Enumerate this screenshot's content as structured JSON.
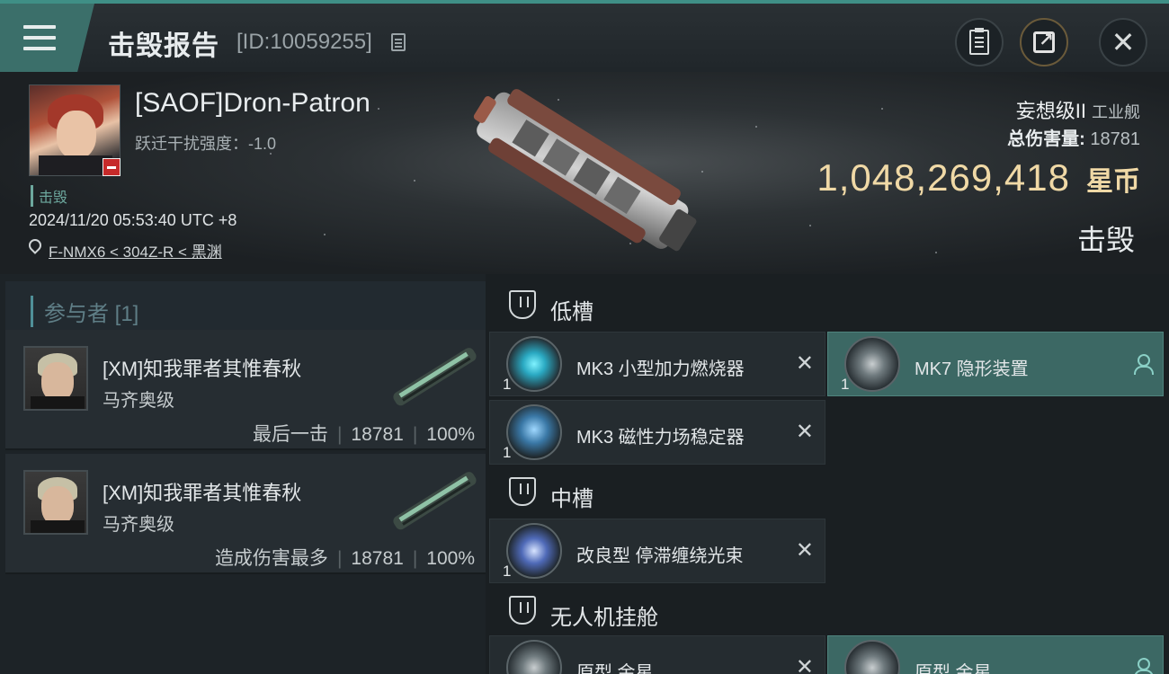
{
  "header": {
    "title": "击毁报告",
    "report_id": "[ID:10059255]"
  },
  "victim": {
    "name": "[SAOF]Dron-Patron",
    "warp_disruption": "跃迁干扰强度：-1.0",
    "status": "击毁",
    "timestamp": "2024/11/20 05:53:40 UTC +8",
    "location": "F-NMX6 < 304Z-R < 黑渊",
    "ship_name": "妄想级II",
    "ship_type": "工业舰",
    "total_damage_label": "总伤害量:",
    "total_damage": "18781",
    "isk_value": "1,048,269,418",
    "isk_unit": "星币",
    "result": "击毁"
  },
  "participants": {
    "header": "参与者 [1]",
    "rows": [
      {
        "pilot": "[XM]知我罪者其惟春秋",
        "ship": "马齐奥级",
        "role": "最后一击",
        "damage": "18781",
        "percent": "100%"
      },
      {
        "pilot": "[XM]知我罪者其惟春秋",
        "ship": "马齐奥级",
        "role": "造成伤害最多",
        "damage": "18781",
        "percent": "100%"
      }
    ]
  },
  "fitting": {
    "low_slot_label": "低槽",
    "mid_slot_label": "中槽",
    "drone_bay_label": "无人机挂舱",
    "low_slots": [
      {
        "name": "MK3 小型加力燃烧器",
        "qty": "1",
        "icon": "afterburner-icon"
      },
      {
        "name": "MK7 隐形装置",
        "qty": "1",
        "icon": "cloak-icon"
      },
      {
        "name": "MK3 磁性力场稳定器",
        "qty": "1",
        "icon": "stabilizer-icon"
      }
    ],
    "mid_slots": [
      {
        "name": "改良型 停滞缠绕光束",
        "qty": "1",
        "icon": "stasis-web-icon"
      }
    ],
    "drones": [
      {
        "name": "原型 金星",
        "qty": "",
        "icon": "drone-icon"
      },
      {
        "name": "原型 金星",
        "qty": "",
        "icon": "drone-icon"
      }
    ]
  },
  "colors": {
    "accent_teal": "#3b6f6a",
    "isk_gold": "#f0d9a6",
    "selected_module": "#3c6864"
  }
}
